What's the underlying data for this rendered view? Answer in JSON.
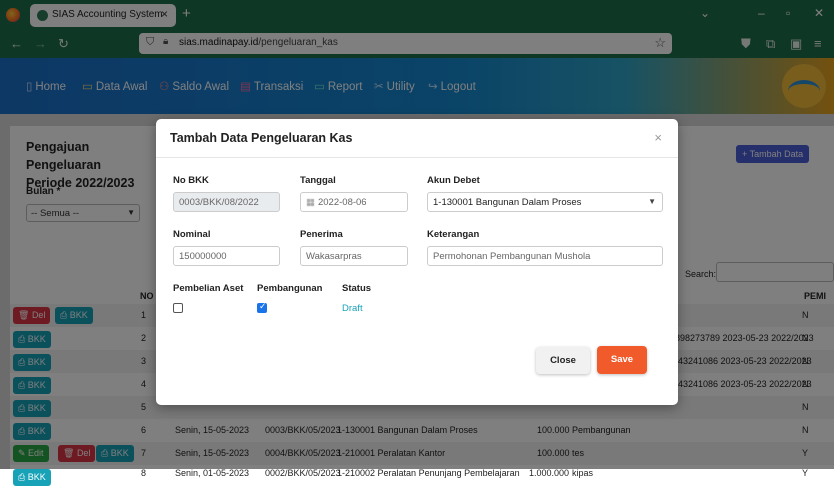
{
  "browser": {
    "tab_title": "SIAS Accounting System",
    "url_domain": "sias.madinapay.id",
    "url_path": "/pengeluaran_kas"
  },
  "menu": [
    {
      "label": "Home",
      "icon": "home-icon"
    },
    {
      "label": "Data Awal",
      "icon": "monitor-icon"
    },
    {
      "label": "Saldo Awal",
      "icon": "users-icon"
    },
    {
      "label": "Transaksi",
      "icon": "cart-icon"
    },
    {
      "label": "Report",
      "icon": "report-icon"
    },
    {
      "label": "Utility",
      "icon": "tools-icon"
    },
    {
      "label": "Logout",
      "icon": "logout-icon"
    }
  ],
  "page": {
    "title_line1": "Pengajuan Pengeluaran",
    "title_line2": "Periode 2022/2023",
    "add_button": "+ Tambah Data",
    "bulan_label": "Bulan *",
    "bulan_value": "-- Semua --",
    "search_label": "Search:"
  },
  "table": {
    "headers": {
      "no": "NO",
      "pem": "PEMI"
    },
    "rows": [
      {
        "no": "1",
        "tail": "N",
        "actions": [
          "Del",
          "BKK"
        ]
      },
      {
        "no": "2",
        "ref": "4898273789 2023-05-23 2022/2023",
        "tail": "N",
        "actions": [
          "BKK"
        ]
      },
      {
        "no": "3",
        "ref": "43241086 2023-05-23 2022/2023",
        "tail": "N",
        "actions": [
          "BKK"
        ]
      },
      {
        "no": "4",
        "ref": "43241086 2023-05-23 2022/2023",
        "tail": "N",
        "actions": [
          "BKK"
        ]
      },
      {
        "no": "5",
        "tail": "N",
        "actions": [
          "BKK"
        ]
      },
      {
        "no": "6",
        "date": "Senin, 15-05-2023",
        "bkk": "0003/BKK/05/2023",
        "akun": "1-130001 Bangunan Dalam Proses",
        "amount": "100.000",
        "ket": "Pembangunan",
        "tail": "N",
        "actions": [
          "BKK"
        ]
      },
      {
        "no": "7",
        "date": "Senin, 15-05-2023",
        "bkk": "0004/BKK/05/2023",
        "akun": "1-210001 Peralatan Kantor",
        "amount": "100.000",
        "ket": "tes",
        "tail": "Y",
        "actions": [
          "Edit",
          "Del",
          "BKK"
        ]
      },
      {
        "no": "8",
        "date": "Senin, 01-05-2023",
        "bkk": "0002/BKK/05/2023",
        "akun": "1-210002 Peralatan Penunjang Pembelajaran",
        "amount": "1.000.000",
        "ket": "kipas",
        "tail": "Y",
        "actions": [
          "BKK"
        ]
      }
    ]
  },
  "modal": {
    "title": "Tambah Data Pengeluaran Kas",
    "close_symbol": "×",
    "fields": {
      "no_bkk_label": "No BKK",
      "no_bkk_value": "0003/BKK/08/2022",
      "tanggal_label": "Tanggal",
      "tanggal_value": "2022-08-06",
      "akun_label": "Akun Debet",
      "akun_value": "1-130001 Bangunan Dalam Proses",
      "nominal_label": "Nominal",
      "nominal_value": "150000000",
      "penerima_label": "Penerima",
      "penerima_value": "Wakasarpras",
      "keterangan_label": "Keterangan",
      "keterangan_value": "Permohonan Pembangunan Mushola",
      "pembelian_aset_label": "Pembelian Aset",
      "pembangunan_label": "Pembangunan",
      "status_label": "Status",
      "status_value": "Draft"
    },
    "pembelian_aset_checked": false,
    "pembangunan_checked": true,
    "close_button": "Close",
    "save_button": "Save"
  }
}
